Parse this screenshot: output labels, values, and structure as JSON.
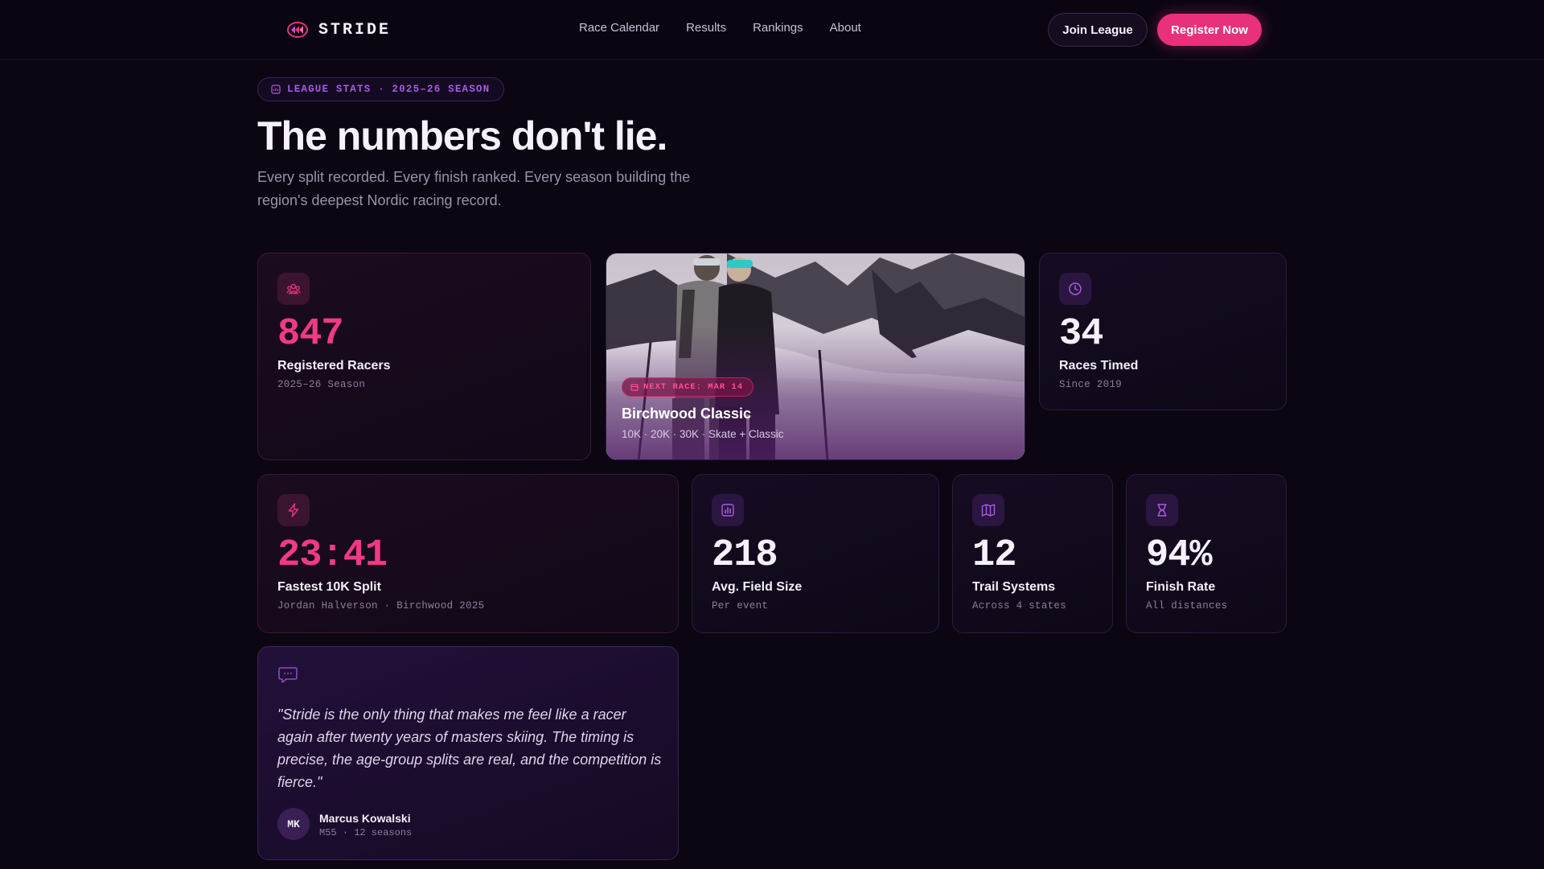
{
  "nav": {
    "brand": "STRIDE",
    "links": [
      "Race Calendar",
      "Results",
      "Rankings",
      "About"
    ],
    "join_label": "Join League",
    "register_label": "Register Now"
  },
  "hero": {
    "badge": "LEAGUE STATS · 2025–26 SEASON",
    "title": "The numbers don't lie.",
    "subtitle": "Every split recorded. Every finish ranked. Every season building the region's deepest Nordic racing record."
  },
  "stats": {
    "racers": {
      "value": "847",
      "label": "Registered Racers",
      "sub": "2025–26 Season",
      "icon": "users-icon"
    },
    "races": {
      "value": "34",
      "label": "Races Timed",
      "sub": "Since 2019",
      "icon": "clock-icon"
    },
    "split": {
      "value": "23:41",
      "label": "Fastest 10K Split",
      "sub": "Jordan Halverson · Birchwood 2025",
      "icon": "lightning-icon"
    },
    "field": {
      "value": "218",
      "label": "Avg. Field Size",
      "sub": "Per event",
      "icon": "bar-chart-icon"
    },
    "trails": {
      "value": "12",
      "label": "Trail Systems",
      "sub": "Across 4 states",
      "icon": "map-icon"
    },
    "finish": {
      "value": "94%",
      "label": "Finish Rate",
      "sub": "All distances",
      "icon": "hourglass-icon"
    }
  },
  "feature": {
    "badge": "NEXT RACE: MAR 14",
    "title": "Birchwood Classic",
    "sub": "10K · 20K · 30K · Skate + Classic"
  },
  "quote": {
    "text": "\"Stride is the only thing that makes me feel like a racer again after twenty years of masters skiing. The timing is precise, the age-group splits are real, and the competition is fierce.\"",
    "initials": "MK",
    "name": "Marcus Kowalski",
    "meta": "M55 · 12 seasons"
  },
  "colors": {
    "accent": "#e8317a",
    "purple": "#a85ce0",
    "background": "#0b0612"
  }
}
